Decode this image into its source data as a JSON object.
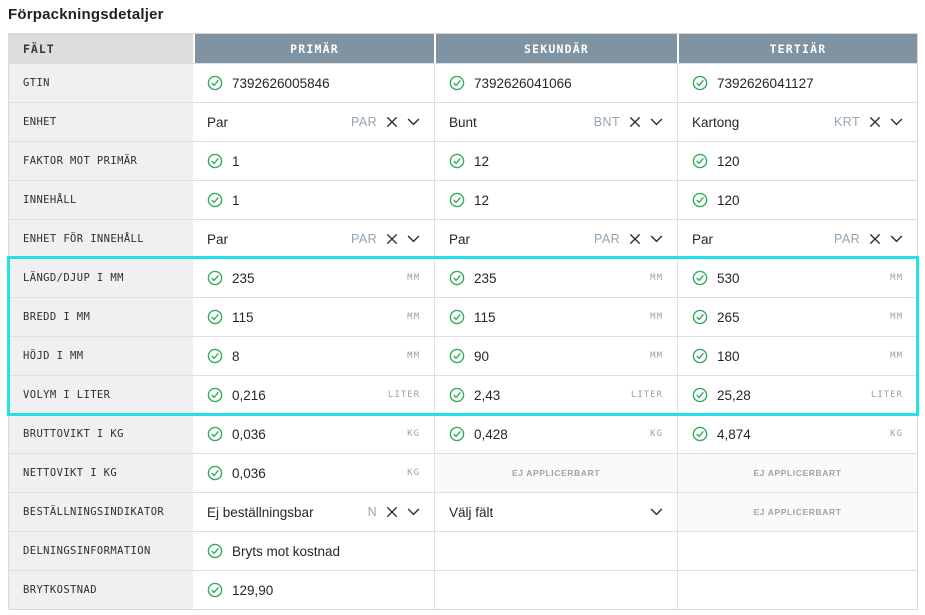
{
  "page": {
    "title": "Förpackningsdetaljer"
  },
  "table": {
    "columns": [
      "FÄLT",
      "PRIMÄR",
      "SEKUNDÄR",
      "TERTIÄR"
    ],
    "na_label": "EJ APPLICERBART",
    "colors": {
      "header_bg": "#7f93a2",
      "header_text": "#ffffff",
      "field_header_bg": "#dcdcdc",
      "label_bg": "#f0f0f0",
      "check_green": "#31ab5d",
      "highlight_cyan": "#23dfe9",
      "code_text": "#94a5b2",
      "unit_text": "#9aa1a7"
    },
    "icons": {
      "check": "check-circle-icon",
      "clear": "clear-x-icon",
      "chevron": "chevron-down-icon"
    },
    "rows": [
      {
        "label": "GTIN",
        "highlighted": false,
        "cells": [
          {
            "type": "check",
            "value": "7392626005846"
          },
          {
            "type": "check",
            "value": "7392626041066"
          },
          {
            "type": "check",
            "value": "7392626041127"
          }
        ]
      },
      {
        "label": "ENHET",
        "highlighted": false,
        "cells": [
          {
            "type": "select",
            "value": "Par",
            "code": "PAR"
          },
          {
            "type": "select",
            "value": "Bunt",
            "code": "BNT"
          },
          {
            "type": "select",
            "value": "Kartong",
            "code": "KRT"
          }
        ]
      },
      {
        "label": "FAKTOR MOT PRIMÄR",
        "highlighted": false,
        "cells": [
          {
            "type": "check",
            "value": "1"
          },
          {
            "type": "check",
            "value": "12"
          },
          {
            "type": "check",
            "value": "120"
          }
        ]
      },
      {
        "label": "INNEHÅLL",
        "highlighted": false,
        "cells": [
          {
            "type": "check",
            "value": "1"
          },
          {
            "type": "check",
            "value": "12"
          },
          {
            "type": "check",
            "value": "120"
          }
        ]
      },
      {
        "label": "ENHET FÖR INNEHÅLL",
        "highlighted": false,
        "cells": [
          {
            "type": "select",
            "value": "Par",
            "code": "PAR"
          },
          {
            "type": "select",
            "value": "Par",
            "code": "PAR"
          },
          {
            "type": "select",
            "value": "Par",
            "code": "PAR"
          }
        ]
      },
      {
        "label": "LÄNGD/DJUP I MM",
        "highlighted": true,
        "cells": [
          {
            "type": "check",
            "value": "235",
            "unit": "MM"
          },
          {
            "type": "check",
            "value": "235",
            "unit": "MM"
          },
          {
            "type": "check",
            "value": "530",
            "unit": "MM"
          }
        ]
      },
      {
        "label": "BREDD I MM",
        "highlighted": true,
        "cells": [
          {
            "type": "check",
            "value": "115",
            "unit": "MM"
          },
          {
            "type": "check",
            "value": "115",
            "unit": "MM"
          },
          {
            "type": "check",
            "value": "265",
            "unit": "MM"
          }
        ]
      },
      {
        "label": "HÖJD I MM",
        "highlighted": true,
        "cells": [
          {
            "type": "check",
            "value": "8",
            "unit": "MM"
          },
          {
            "type": "check",
            "value": "90",
            "unit": "MM"
          },
          {
            "type": "check",
            "value": "180",
            "unit": "MM"
          }
        ]
      },
      {
        "label": "VOLYM I LITER",
        "highlighted": true,
        "cells": [
          {
            "type": "check",
            "value": "0,216",
            "unit": "LITER"
          },
          {
            "type": "check",
            "value": "2,43",
            "unit": "LITER"
          },
          {
            "type": "check",
            "value": "25,28",
            "unit": "LITER"
          }
        ]
      },
      {
        "label": "BRUTTOVIKT I KG",
        "highlighted": false,
        "cells": [
          {
            "type": "check",
            "value": "0,036",
            "unit": "KG"
          },
          {
            "type": "check",
            "value": "0,428",
            "unit": "KG"
          },
          {
            "type": "check",
            "value": "4,874",
            "unit": "KG"
          }
        ]
      },
      {
        "label": "NETTOVIKT I KG",
        "highlighted": false,
        "cells": [
          {
            "type": "check",
            "value": "0,036",
            "unit": "KG"
          },
          {
            "type": "na"
          },
          {
            "type": "na"
          }
        ]
      },
      {
        "label": "BESTÄLLNINGSINDIKATOR",
        "highlighted": false,
        "cells": [
          {
            "type": "select",
            "value": "Ej beställningsbar",
            "code": "N"
          },
          {
            "type": "select-placeholder",
            "value": "Välj fält"
          },
          {
            "type": "na"
          }
        ]
      },
      {
        "label": "DELNINGSINFORMATION",
        "highlighted": false,
        "cells": [
          {
            "type": "check",
            "value": "Bryts mot kostnad"
          },
          {
            "type": "empty"
          },
          {
            "type": "empty"
          }
        ]
      },
      {
        "label": "BRYTKOSTNAD",
        "highlighted": false,
        "cells": [
          {
            "type": "check",
            "value": "129,90"
          },
          {
            "type": "empty"
          },
          {
            "type": "empty"
          }
        ]
      }
    ]
  }
}
